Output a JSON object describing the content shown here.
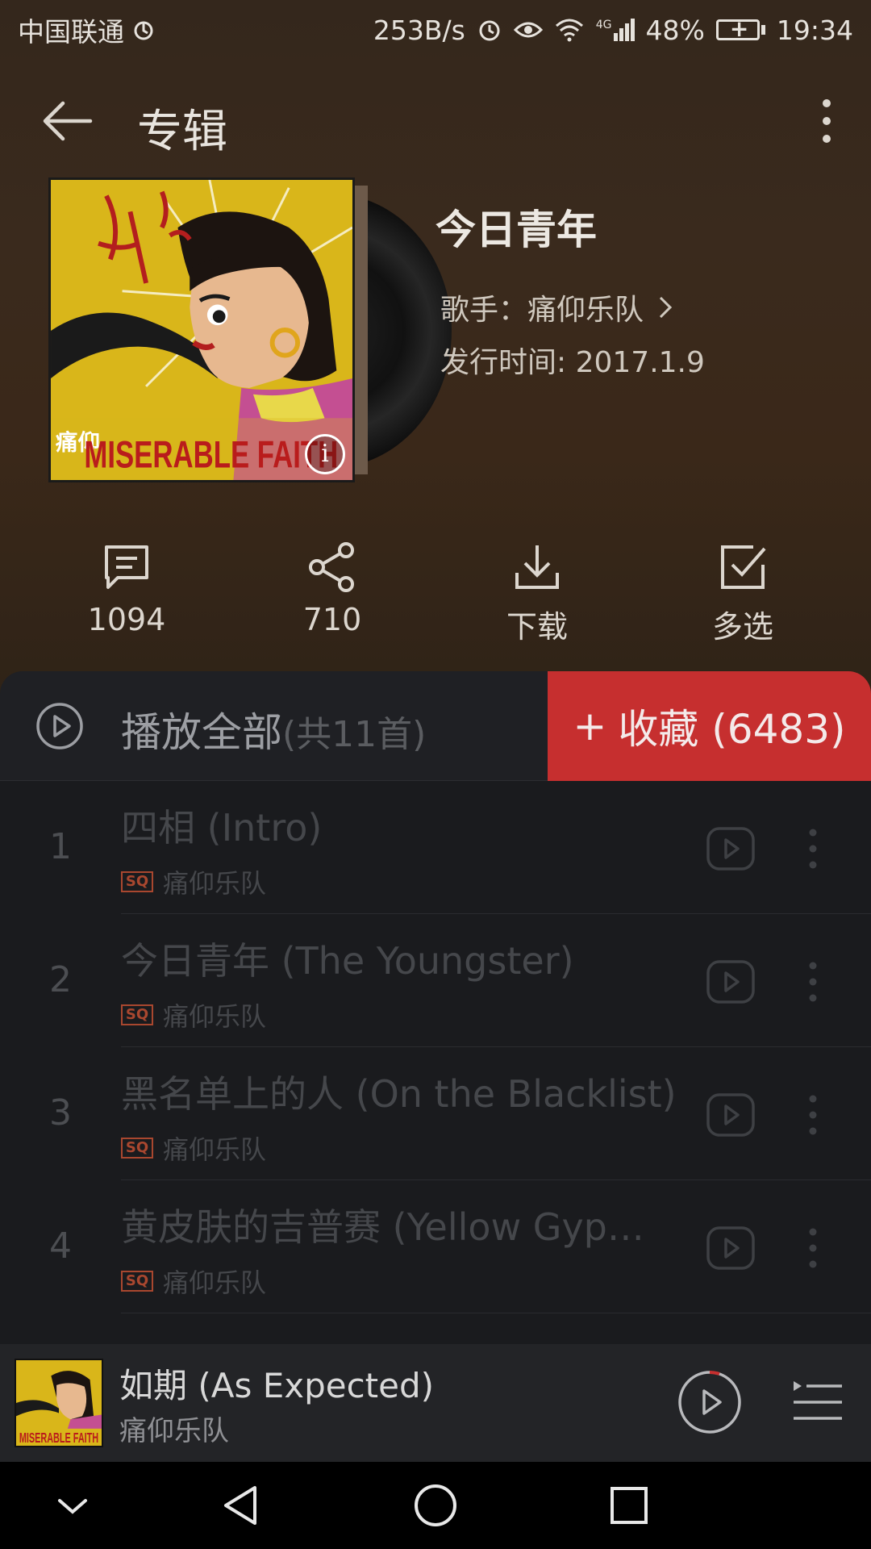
{
  "status_bar": {
    "carrier": "中国联通",
    "speed": "253B/s",
    "network": "4G",
    "battery": "48%",
    "time": "19:34"
  },
  "header": {
    "title": "专辑"
  },
  "album": {
    "name": "今日青年",
    "artist_label": "歌手：",
    "artist": "痛仰乐队",
    "release_label": "发行时间: ",
    "release_date": "2017.1.9",
    "cover_text_band": "MISERABLE FAITH",
    "cover_text_cn": "痛仰"
  },
  "actions": [
    {
      "icon": "comment-icon",
      "label": "1094"
    },
    {
      "icon": "share-icon",
      "label": "710"
    },
    {
      "icon": "download-icon",
      "label": "下载"
    },
    {
      "icon": "multiselect-icon",
      "label": "多选"
    }
  ],
  "play_all": {
    "label": "播放全部",
    "count": "(共11首)"
  },
  "collect": {
    "plus": "+",
    "label": "收藏 (6483)"
  },
  "songs": [
    {
      "index": "1",
      "title": "四相 (Intro)",
      "quality": "SQ",
      "artist": "痛仰乐队"
    },
    {
      "index": "2",
      "title": "今日青年 (The Youngster)",
      "quality": "SQ",
      "artist": "痛仰乐队"
    },
    {
      "index": "3",
      "title": "黑名单上的人 (On the Blacklist)",
      "quality": "SQ",
      "artist": "痛仰乐队"
    },
    {
      "index": "4",
      "title": "黄皮肤的吉普赛 (Yellow Gyp…",
      "quality": "SQ",
      "artist": "痛仰乐队"
    }
  ],
  "mini_player": {
    "song": "如期 (As Expected)",
    "artist": "痛仰乐队"
  },
  "colors": {
    "accent_red": "#c62f2f",
    "background": "#1a1b1e",
    "sq_badge": "#a9472f"
  }
}
